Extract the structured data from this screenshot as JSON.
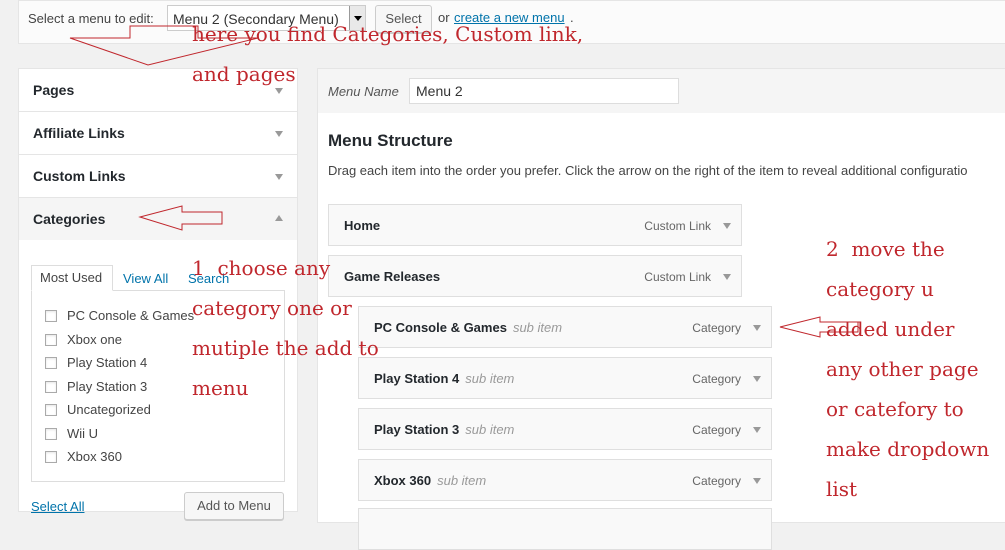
{
  "topbar": {
    "label": "Select a menu to edit:",
    "selected_menu": "Menu 2 (Secondary Menu)",
    "select_button": "Select",
    "or_text": "or",
    "create_link": "create a new menu",
    "period": "."
  },
  "accordion": {
    "pages": "Pages",
    "affiliate_links": "Affiliate Links",
    "custom_links": "Custom Links",
    "categories": "Categories"
  },
  "tabs": {
    "most_used": "Most Used",
    "view_all": "View All",
    "search": "Search"
  },
  "categories": [
    "PC Console & Games",
    "Xbox one",
    "Play Station 4",
    "Play Station 3",
    "Uncategorized",
    "Wii U",
    "Xbox 360"
  ],
  "select_all": "Select All",
  "add_to_menu": "Add to Menu",
  "menu_name": {
    "label": "Menu Name",
    "value": "Menu 2"
  },
  "structure": {
    "title": "Menu Structure",
    "description": "Drag each item into the order you prefer. Click the arrow on the right of the item to reveal additional configuratio"
  },
  "menu_items": [
    {
      "title": "Home",
      "sub": "",
      "type": "Custom Link"
    },
    {
      "title": "Game Releases",
      "sub": "",
      "type": "Custom Link"
    },
    {
      "title": "PC Console & Games",
      "sub": "sub item",
      "type": "Category"
    },
    {
      "title": "Play Station 4",
      "sub": "sub item",
      "type": "Category"
    },
    {
      "title": "Play Station 3",
      "sub": "sub item",
      "type": "Category"
    },
    {
      "title": "Xbox 360",
      "sub": "sub item",
      "type": "Category"
    }
  ],
  "annotations": {
    "top": "here you find Categories, Custom link,\nand pages",
    "left": "1  choose any\ncategory one or\nmutiple the add to\nmenu",
    "right": "2  move the\ncategory u\nadded under\nany other page\nor catefory to\nmake dropdown\nlist"
  },
  "colors": {
    "annotation": "#c0272d",
    "link": "#0073aa"
  }
}
